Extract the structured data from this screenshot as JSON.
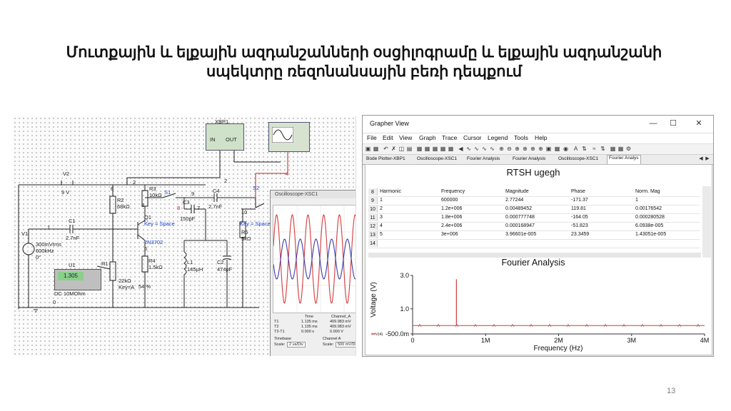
{
  "slide": {
    "title_line1": "Մուտքային և ելքային ազդանշանների օսցիլոգրամը և ելքային ազդանշանի",
    "title_line2": "սպեկտրը ռեզոնանսային բեռի դեպքում",
    "page_number": "13"
  },
  "schematic": {
    "xbp1_label": "XBP1",
    "xbp1_in": "IN",
    "xbp1_out": "OUT",
    "v2_name": "V2",
    "v2_value": "9 V",
    "r3": "R3",
    "r3_value": "10kΩ",
    "r2": "R2",
    "r2_value": "68kΩ",
    "s1": "S1",
    "s2": "S2",
    "c3": "C3",
    "c3_value": "150pF",
    "c4": "C4",
    "c4_value": "2.7nF",
    "c1": "C1",
    "c1_value": "2.7nF",
    "v1": "V1",
    "v1_val1": "300mVrms",
    "v1_val2": "600kHz",
    "v1_val3": "0°",
    "q1": "Q1",
    "q1_model": "2N3702",
    "key_space1": "Key = Space",
    "key_space2": "Key = Space",
    "r4": "R4",
    "r4_value": "1.5kΩ",
    "l1": "L1",
    "l1_value": "145µH",
    "c2": "C2",
    "c2_value": "474pF",
    "r5": "R5",
    "r5_value": "5kΩ",
    "r1": "R1",
    "r1_value": "22kΩ",
    "r1_key": "Key=A",
    "r1_pct": "54 %",
    "u1": "U1",
    "u1_display": "1.305",
    "u1_mode": "DC  10MOhm",
    "nodes": {
      "n1": "1",
      "n2": "2",
      "n3": "3",
      "n4": "4",
      "n6": "6",
      "n7": "7",
      "n8": "8",
      "n9": "9",
      "n10": "10",
      "n0": "0",
      "n6b": "6"
    }
  },
  "scope": {
    "title": "Oscilloscope-XSC1",
    "time_hdr": "Time",
    "chA_hdr": "Channel_A",
    "chA_hdr2": "Channel A",
    "t1_label": "T1",
    "t2_label": "T2",
    "t21_label": "T2-T1",
    "t1_time": "1.135 ms",
    "t2_time": "1.135 ms",
    "t21_time": "0.000 s",
    "t1_val": "409.983 mV",
    "t2_val": "409.983 mV",
    "t21_val": "0.000 V",
    "timebase_label": "Timebase",
    "timebase_scale_label": "Scale:",
    "timebase_scale": "2 us/Div",
    "ch_scale_label": "Scale:",
    "ch_scale": "500 mV/Div"
  },
  "grapher": {
    "window_title": "Grapher View",
    "menu": [
      "File",
      "Edit",
      "View",
      "Graph",
      "Trace",
      "Cursor",
      "Legend",
      "Tools",
      "Help"
    ],
    "tabs": [
      "Bode Plotter-XBP1",
      "Oscilloscope-XSC1",
      "Fourier Analysis",
      "Fourier Analysis",
      "Oscilloscope-XSC1",
      "Fourier Analys"
    ],
    "chart_heading": "RTSH ugegh",
    "table_headers": [
      "Harmonic",
      "Frequency",
      "Magnitude",
      "Phase",
      "Norm. Mag"
    ],
    "header_row_num": "8",
    "rows": [
      {
        "num": "9",
        "harmonic": "1",
        "frequency": "600000",
        "magnitude": "2.77244",
        "phase": "-171.37",
        "norm": "1"
      },
      {
        "num": "10",
        "harmonic": "2",
        "frequency": "1.2e+006",
        "magnitude": "0.00489452",
        "phase": "119.81",
        "norm": "0.00176542"
      },
      {
        "num": "11",
        "harmonic": "3",
        "frequency": "1.8e+006",
        "magnitude": "0.000777748",
        "phase": "-164.05",
        "norm": "0.000280528"
      },
      {
        "num": "12",
        "harmonic": "4",
        "frequency": "2.4e+006",
        "magnitude": "0.000168947",
        "phase": "-51.823",
        "norm": "6.0938e-005"
      },
      {
        "num": "13",
        "harmonic": "5",
        "frequency": "3e+006",
        "magnitude": "3.96601e-005",
        "phase": "23.3459",
        "norm": "1.43051e-005"
      },
      {
        "num": "14",
        "harmonic": "",
        "frequency": "",
        "magnitude": "",
        "phase": "",
        "norm": ""
      }
    ],
    "legend_label": "V(4)"
  },
  "chart_data": {
    "type": "line",
    "title": "Fourier Analysis",
    "xlabel": "Frequency (Hz)",
    "ylabel": "Voltage (V)",
    "xlim": [
      0,
      4000000
    ],
    "ylim": [
      -0.5,
      3.0
    ],
    "x_ticks": [
      "0",
      "1M",
      "2M",
      "3M",
      "4M"
    ],
    "y_ticks": [
      "3.0",
      "1.0",
      "-500.0m"
    ],
    "series": [
      {
        "name": "V(4)",
        "color": "#d43a3a",
        "x": [
          600000,
          1200000,
          1800000,
          2400000,
          3000000
        ],
        "values": [
          2.77244,
          0.00489452,
          0.000777748,
          0.000168947,
          3.96601e-05
        ]
      }
    ],
    "grid": false
  },
  "colors": {
    "trace_red": "#d43a3a",
    "trace_blue": "#3a3aa6",
    "wire_dark": "#222222",
    "probe_red": "#cc2222"
  }
}
